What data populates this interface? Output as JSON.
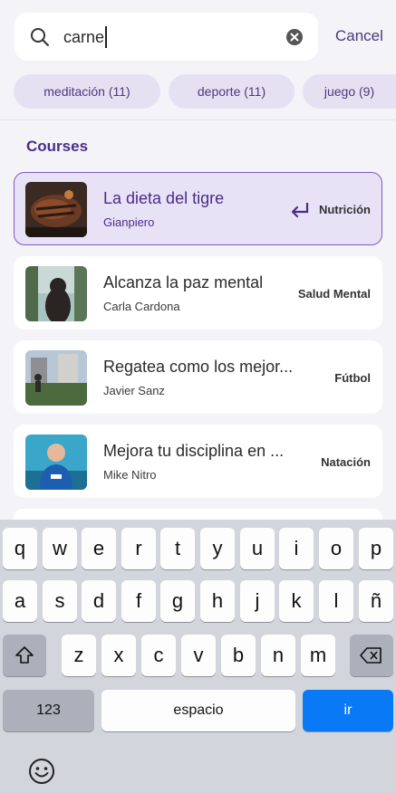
{
  "search": {
    "query": "carne",
    "cancel_label": "Cancel"
  },
  "chips": [
    {
      "label": "meditación (11)"
    },
    {
      "label": "deporte (11)"
    },
    {
      "label": "juego (9)"
    }
  ],
  "section_title": "Courses",
  "courses": [
    {
      "title": "La dieta del tigre",
      "author": "Gianpiero",
      "category": "Nutrición",
      "selected": true
    },
    {
      "title": "Alcanza la paz mental",
      "author": "Carla Cardona",
      "category": "Salud Mental",
      "selected": false
    },
    {
      "title": "Regatea como los mejor...",
      "author": "Javier Sanz",
      "category": "Fútbol",
      "selected": false
    },
    {
      "title": "Mejora tu disciplina en ...",
      "author": "Mike Nitro",
      "category": "Natación",
      "selected": false
    }
  ],
  "keyboard": {
    "row1": [
      "q",
      "w",
      "e",
      "r",
      "t",
      "y",
      "u",
      "i",
      "o",
      "p"
    ],
    "row2": [
      "a",
      "s",
      "d",
      "f",
      "g",
      "h",
      "j",
      "k",
      "l",
      "ñ"
    ],
    "row3": [
      "z",
      "x",
      "c",
      "v",
      "b",
      "n",
      "m"
    ],
    "numbers_label": "123",
    "space_label": "espacio",
    "go_label": "ir"
  },
  "colors": {
    "accent": "#4a2d8a",
    "chip_bg": "#e6e1f2",
    "selected_card_bg": "#e8e2f6",
    "keyboard_go": "#0a79f5"
  }
}
